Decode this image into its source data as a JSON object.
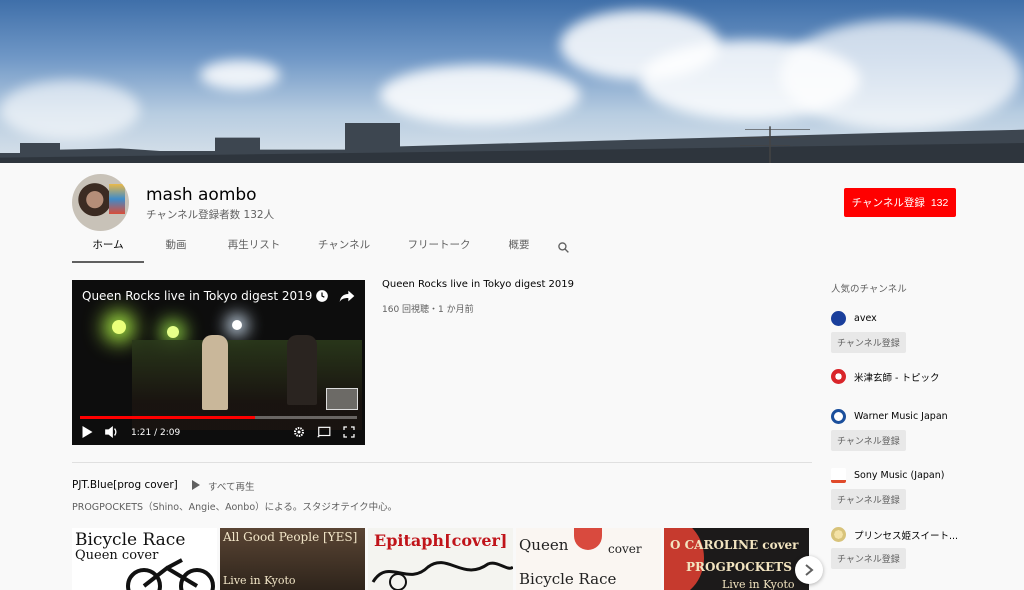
{
  "channel": {
    "name": "mash aombo",
    "subscribers": "チャンネル登録者数 132人",
    "subscribe_label": "チャンネル登録",
    "subscribe_count": "132"
  },
  "tabs": [
    {
      "label": "ホーム",
      "active": true
    },
    {
      "label": "動画"
    },
    {
      "label": "再生リスト"
    },
    {
      "label": "チャンネル"
    },
    {
      "label": "フリートーク"
    },
    {
      "label": "概要"
    }
  ],
  "featured": {
    "overlay_title": "Queen Rocks live in Tokyo digest 2019",
    "title": "Queen Rocks live in Tokyo digest 2019",
    "meta": "160 回視聴・1 か月前",
    "time": "1:21 / 2:09",
    "progress_fraction": 0.63
  },
  "shelf": {
    "title": "PJT.Blue[prog cover]",
    "play_all": "すべて再生",
    "description": "PROGPOCKETS（Shino、Angie、Aonbo）による。スタジオテイク中心。",
    "thumbnails": [
      {
        "line1": "Bicycle Race",
        "line2": "Queen cover"
      },
      {
        "line1": "All Good People [YES]",
        "line2": "Live in Kyoto"
      },
      {
        "line1": "Epitaph[cover]"
      },
      {
        "line1": "Queen",
        "line2": "cover",
        "line3": "Bicycle Race"
      },
      {
        "line1": "O CAROLINE cover",
        "line2": "PROGPOCKETS",
        "line3": "Live in Kyoto"
      }
    ]
  },
  "sidebar": {
    "heading": "人気のチャンネル",
    "subscribe_label": "チャンネル登録",
    "channels": [
      {
        "name": "avex",
        "color": "#1a3f9c"
      },
      {
        "name": "米津玄師 - トピック",
        "color": "#d9252a"
      },
      {
        "name": "Warner Music Japan",
        "color": "#1b4f9c"
      },
      {
        "name": "Sony Music (Japan)",
        "color": "#e04a2a"
      },
      {
        "name": "プリンセス姫スイート..."
      }
    ]
  },
  "colors": {
    "accent": "#ff0000",
    "text": "#030303",
    "secondary": "#606060"
  }
}
